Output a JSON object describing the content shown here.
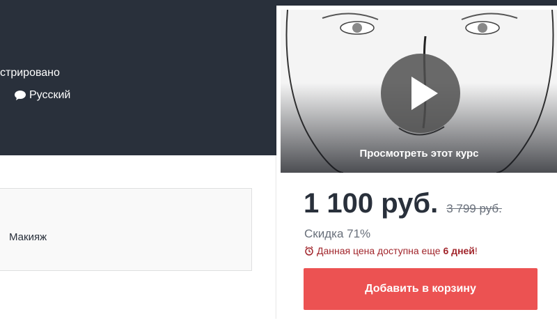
{
  "hero": {
    "text_partial": "стрировано",
    "language": "Русский"
  },
  "info_box": {
    "category": "Макияж"
  },
  "preview": {
    "label": "Просмотреть этот курс"
  },
  "pricing": {
    "price": "1 100 руб.",
    "old_price": "3 799 руб.",
    "discount": "Скидка 71%",
    "timer_prefix": "Данная цена доступна еще",
    "timer_days": "6 дней",
    "timer_suffix": "!"
  },
  "cart": {
    "button_label": "Добавить в корзину"
  },
  "colors": {
    "hero_bg": "#29303b",
    "accent": "#ec5252"
  }
}
